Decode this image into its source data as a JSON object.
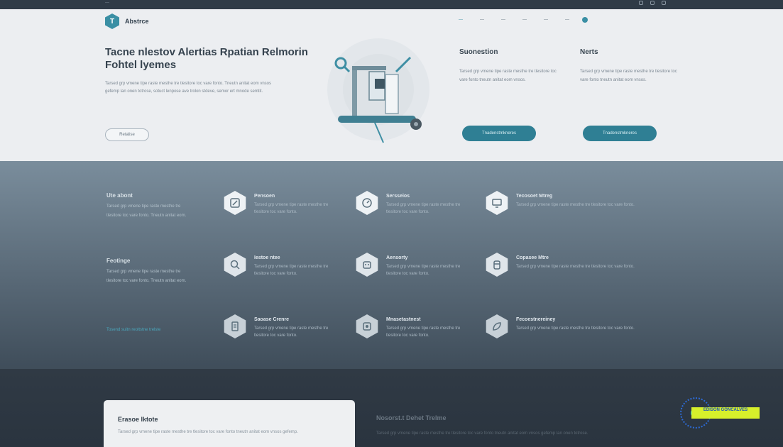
{
  "topbar": {
    "crumb": "—"
  },
  "brand": {
    "name": "Abstrce",
    "mark": "T"
  },
  "nav": {
    "items": [
      "—",
      "—",
      "—",
      "—",
      "—",
      "—"
    ],
    "help": "?"
  },
  "hero": {
    "title": "Tacne nlestov Alertias Rpatian Relmorin Fohtel lyemes",
    "paragraph": "Tarsed grp vmene tipe raste mesthe tre tlesitore toc vare fonto. Tneutn anitat eom vnsos gefemp lan onen totrose, sotuct lenpose ave trolon stdeve, semor ert mnode semtit.",
    "button_label": "Retalise"
  },
  "cards": [
    {
      "title": "Suonestion",
      "text": "Tarsed grp vmene tipe raste mesthe tre tlesitore toc vare fonto tneutn anitat eom vnsos.",
      "button_label": "Tnadenstmkneres"
    },
    {
      "title": "Nerts",
      "text": "Tarsed grp vmene tipe raste mesthe tre tlesitore toc vare fonto tneutn anitat eom vnsos.",
      "button_label": "Tnadenstmkneres"
    }
  ],
  "features_side": [
    {
      "heading": "Ute abont",
      "text": "Tarsed grp vmene tipe raste mesthe tre tlesitore toc vare fonto. Tneutn anitat eom."
    },
    {
      "heading": "Feotinge",
      "text": "Tarsed grp vmene tipe raste mesthe tre tlesitore toc vare fonto. Tneutn anitat eom."
    }
  ],
  "features_footer": "Tosend suitn reoltstne trelste",
  "features": [
    {
      "icon": "edit-icon",
      "title": "Pensoen",
      "text": "Tarsed grp vmene tipe raste mesthe tre tlesitore toc vare fonto."
    },
    {
      "icon": "gauge-icon",
      "title": "Sersseios",
      "text": "Tarsed grp vmene tipe raste mesthe tre tlesitore toc vare fonto."
    },
    {
      "icon": "monitor-icon",
      "title": "Tecosoet Mtreg",
      "text": "Tarsed grp vmene tipe raste mesthe tre tlesitore toc vare fonto."
    },
    {
      "icon": "search-icon",
      "title": "Iestoe ntee",
      "text": "Tarsed grp vmene tipe raste mesthe tre tlesitore toc vare fonto."
    },
    {
      "icon": "robot-icon",
      "title": "Aensorty",
      "text": "Tarsed grp vmene tipe raste mesthe tre tlesitore toc vare fonto."
    },
    {
      "icon": "tank-icon",
      "title": "Copasee Mtre",
      "text": "Tarsed grp vmene tipe raste mesthe tre tlesitore toc vare fonto."
    },
    {
      "icon": "document-icon",
      "title": "Saoase Crenre",
      "text": "Tarsed grp vmene tipe raste mesthe tre tlesitore toc vare fonto."
    },
    {
      "icon": "device-icon",
      "title": "Mnasetastnest",
      "text": "Tarsed grp vmene tipe raste mesthe tre tlesitore toc vare fonto."
    },
    {
      "icon": "leaf-icon",
      "title": "Fecoestnereiney",
      "text": "Tarsed grp vmene tipe raste mesthe tre tlesitore toc vare fonto."
    }
  ],
  "bottom": {
    "card_title": "Erasoe lktote",
    "card_text": "Tarsed grp vmene tipe raste mesthe tre tlesitore toc vare fonto tneutn anitat eom vnsos gefemp.",
    "right_title": "Nosorst.t Dehet Trelme",
    "right_text": "Tarsed grp vmene tipe raste mesthe tre tlesitore toc vare fonto tneutn anitat eom vnsos gefemp lan onen totrose."
  },
  "badge": {
    "text": "EDISON GONCALVES"
  },
  "colors": {
    "accent": "#2f7f94",
    "hero_bg": "#eceef1",
    "features_bg": "#7a8d9c",
    "bottom_bg": "#2b3540",
    "badge": "#d7f02b"
  }
}
